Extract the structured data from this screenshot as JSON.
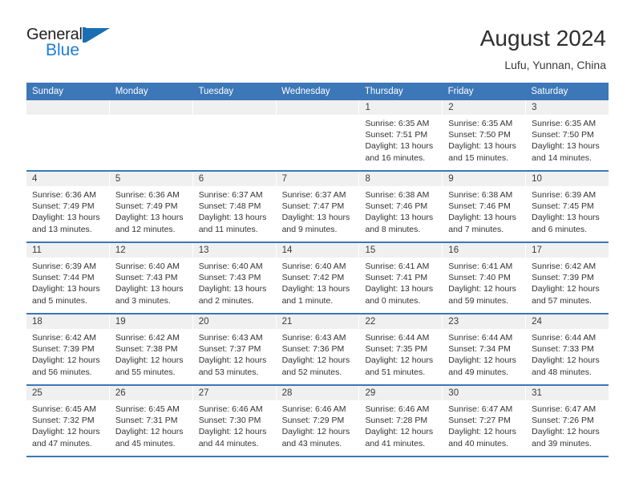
{
  "brand": {
    "word1": "General",
    "word2": "Blue",
    "mark": "triangle-flag",
    "color_dark": "#231f20",
    "color_blue": "#1a7fd4"
  },
  "header": {
    "title": "August 2024",
    "subtitle": "Lufu, Yunnan, China"
  },
  "theme": {
    "header_blue": "#3c77b8",
    "daynum_band": "#f0f0f0",
    "text": "#333333"
  },
  "calendar": {
    "weekdays": [
      "Sunday",
      "Monday",
      "Tuesday",
      "Wednesday",
      "Thursday",
      "Friday",
      "Saturday"
    ],
    "weeks": [
      [
        {
          "day": "",
          "lines": []
        },
        {
          "day": "",
          "lines": []
        },
        {
          "day": "",
          "lines": []
        },
        {
          "day": "",
          "lines": []
        },
        {
          "day": "1",
          "lines": [
            "Sunrise: 6:35 AM",
            "Sunset: 7:51 PM",
            "Daylight: 13 hours",
            "and 16 minutes."
          ]
        },
        {
          "day": "2",
          "lines": [
            "Sunrise: 6:35 AM",
            "Sunset: 7:50 PM",
            "Daylight: 13 hours",
            "and 15 minutes."
          ]
        },
        {
          "day": "3",
          "lines": [
            "Sunrise: 6:35 AM",
            "Sunset: 7:50 PM",
            "Daylight: 13 hours",
            "and 14 minutes."
          ]
        }
      ],
      [
        {
          "day": "4",
          "lines": [
            "Sunrise: 6:36 AM",
            "Sunset: 7:49 PM",
            "Daylight: 13 hours",
            "and 13 minutes."
          ]
        },
        {
          "day": "5",
          "lines": [
            "Sunrise: 6:36 AM",
            "Sunset: 7:49 PM",
            "Daylight: 13 hours",
            "and 12 minutes."
          ]
        },
        {
          "day": "6",
          "lines": [
            "Sunrise: 6:37 AM",
            "Sunset: 7:48 PM",
            "Daylight: 13 hours",
            "and 11 minutes."
          ]
        },
        {
          "day": "7",
          "lines": [
            "Sunrise: 6:37 AM",
            "Sunset: 7:47 PM",
            "Daylight: 13 hours",
            "and 9 minutes."
          ]
        },
        {
          "day": "8",
          "lines": [
            "Sunrise: 6:38 AM",
            "Sunset: 7:46 PM",
            "Daylight: 13 hours",
            "and 8 minutes."
          ]
        },
        {
          "day": "9",
          "lines": [
            "Sunrise: 6:38 AM",
            "Sunset: 7:46 PM",
            "Daylight: 13 hours",
            "and 7 minutes."
          ]
        },
        {
          "day": "10",
          "lines": [
            "Sunrise: 6:39 AM",
            "Sunset: 7:45 PM",
            "Daylight: 13 hours",
            "and 6 minutes."
          ]
        }
      ],
      [
        {
          "day": "11",
          "lines": [
            "Sunrise: 6:39 AM",
            "Sunset: 7:44 PM",
            "Daylight: 13 hours",
            "and 5 minutes."
          ]
        },
        {
          "day": "12",
          "lines": [
            "Sunrise: 6:40 AM",
            "Sunset: 7:43 PM",
            "Daylight: 13 hours",
            "and 3 minutes."
          ]
        },
        {
          "day": "13",
          "lines": [
            "Sunrise: 6:40 AM",
            "Sunset: 7:43 PM",
            "Daylight: 13 hours",
            "and 2 minutes."
          ]
        },
        {
          "day": "14",
          "lines": [
            "Sunrise: 6:40 AM",
            "Sunset: 7:42 PM",
            "Daylight: 13 hours",
            "and 1 minute."
          ]
        },
        {
          "day": "15",
          "lines": [
            "Sunrise: 6:41 AM",
            "Sunset: 7:41 PM",
            "Daylight: 13 hours",
            "and 0 minutes."
          ]
        },
        {
          "day": "16",
          "lines": [
            "Sunrise: 6:41 AM",
            "Sunset: 7:40 PM",
            "Daylight: 12 hours",
            "and 59 minutes."
          ]
        },
        {
          "day": "17",
          "lines": [
            "Sunrise: 6:42 AM",
            "Sunset: 7:39 PM",
            "Daylight: 12 hours",
            "and 57 minutes."
          ]
        }
      ],
      [
        {
          "day": "18",
          "lines": [
            "Sunrise: 6:42 AM",
            "Sunset: 7:39 PM",
            "Daylight: 12 hours",
            "and 56 minutes."
          ]
        },
        {
          "day": "19",
          "lines": [
            "Sunrise: 6:42 AM",
            "Sunset: 7:38 PM",
            "Daylight: 12 hours",
            "and 55 minutes."
          ]
        },
        {
          "day": "20",
          "lines": [
            "Sunrise: 6:43 AM",
            "Sunset: 7:37 PM",
            "Daylight: 12 hours",
            "and 53 minutes."
          ]
        },
        {
          "day": "21",
          "lines": [
            "Sunrise: 6:43 AM",
            "Sunset: 7:36 PM",
            "Daylight: 12 hours",
            "and 52 minutes."
          ]
        },
        {
          "day": "22",
          "lines": [
            "Sunrise: 6:44 AM",
            "Sunset: 7:35 PM",
            "Daylight: 12 hours",
            "and 51 minutes."
          ]
        },
        {
          "day": "23",
          "lines": [
            "Sunrise: 6:44 AM",
            "Sunset: 7:34 PM",
            "Daylight: 12 hours",
            "and 49 minutes."
          ]
        },
        {
          "day": "24",
          "lines": [
            "Sunrise: 6:44 AM",
            "Sunset: 7:33 PM",
            "Daylight: 12 hours",
            "and 48 minutes."
          ]
        }
      ],
      [
        {
          "day": "25",
          "lines": [
            "Sunrise: 6:45 AM",
            "Sunset: 7:32 PM",
            "Daylight: 12 hours",
            "and 47 minutes."
          ]
        },
        {
          "day": "26",
          "lines": [
            "Sunrise: 6:45 AM",
            "Sunset: 7:31 PM",
            "Daylight: 12 hours",
            "and 45 minutes."
          ]
        },
        {
          "day": "27",
          "lines": [
            "Sunrise: 6:46 AM",
            "Sunset: 7:30 PM",
            "Daylight: 12 hours",
            "and 44 minutes."
          ]
        },
        {
          "day": "28",
          "lines": [
            "Sunrise: 6:46 AM",
            "Sunset: 7:29 PM",
            "Daylight: 12 hours",
            "and 43 minutes."
          ]
        },
        {
          "day": "29",
          "lines": [
            "Sunrise: 6:46 AM",
            "Sunset: 7:28 PM",
            "Daylight: 12 hours",
            "and 41 minutes."
          ]
        },
        {
          "day": "30",
          "lines": [
            "Sunrise: 6:47 AM",
            "Sunset: 7:27 PM",
            "Daylight: 12 hours",
            "and 40 minutes."
          ]
        },
        {
          "day": "31",
          "lines": [
            "Sunrise: 6:47 AM",
            "Sunset: 7:26 PM",
            "Daylight: 12 hours",
            "and 39 minutes."
          ]
        }
      ]
    ]
  }
}
